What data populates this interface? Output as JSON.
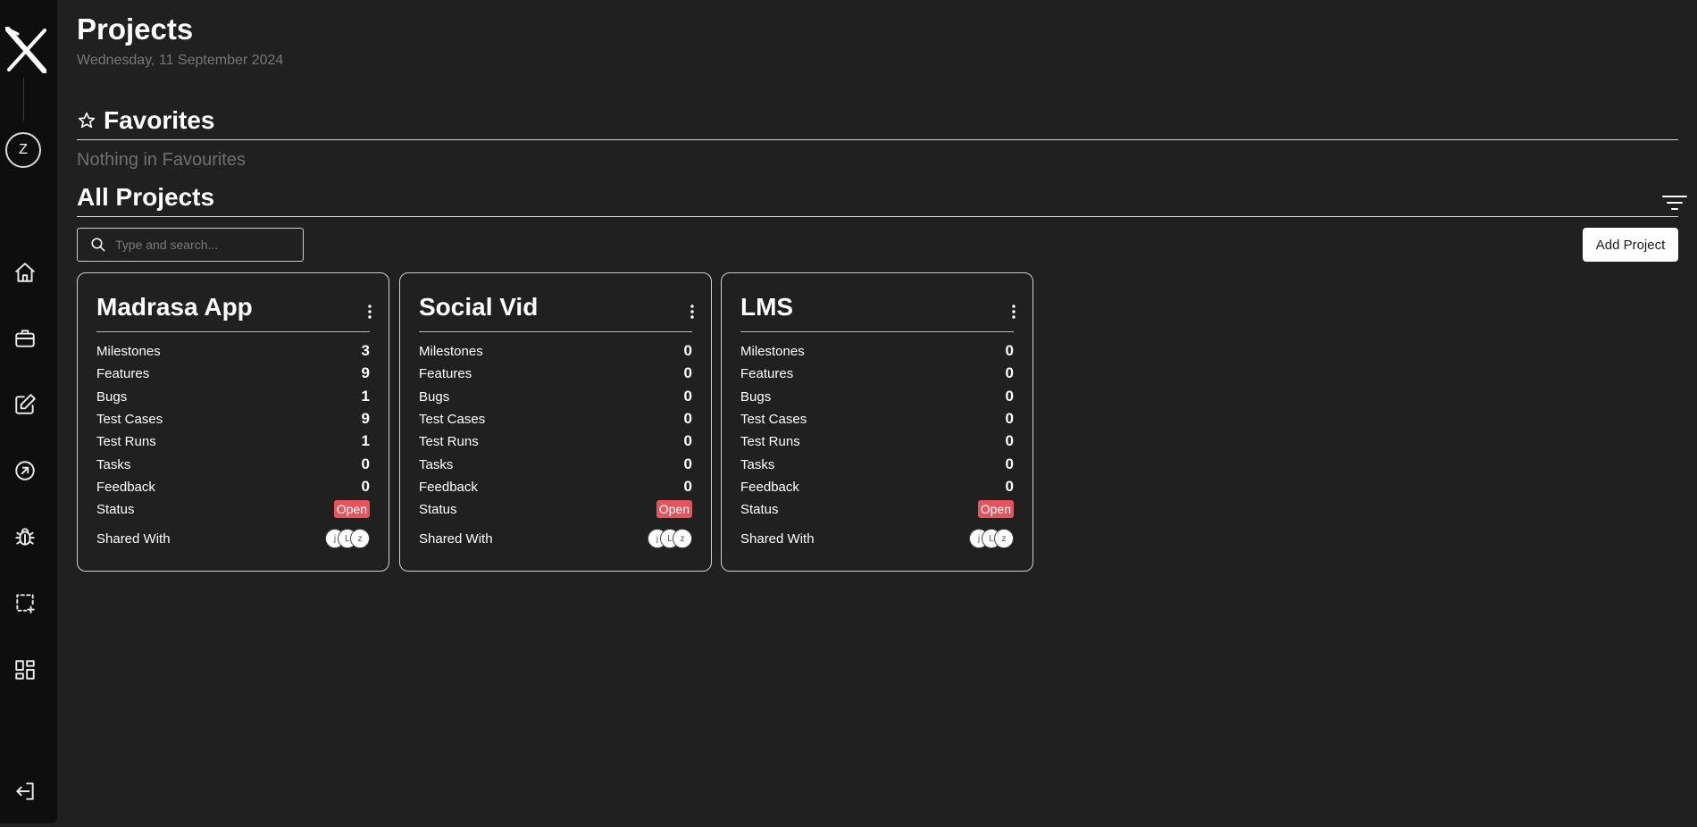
{
  "user": {
    "initial": "Z"
  },
  "header": {
    "title": "Projects",
    "date": "Wednesday, 11 September 2024"
  },
  "favorites": {
    "title": "Favorites",
    "empty_text": "Nothing in Favourites"
  },
  "all_projects": {
    "title": "All Projects",
    "search_placeholder": "Type and search...",
    "add_label": "Add Project"
  },
  "nav": [
    "home-icon",
    "briefcase-icon",
    "edit-icon",
    "arrow-circle-icon",
    "bug-icon",
    "selection-add-icon",
    "dashboard-icon",
    "logout-icon"
  ],
  "colors": {
    "background": "#202020",
    "sidebar": "#0e0e0e",
    "status_open": "#e5545c"
  },
  "labels": {
    "milestones": "Milestones",
    "features": "Features",
    "bugs": "Bugs",
    "test_cases": "Test Cases",
    "test_runs": "Test Runs",
    "tasks": "Tasks",
    "feedback": "Feedback",
    "status": "Status",
    "shared_with": "Shared With"
  },
  "projects": [
    {
      "name": "Madrasa App",
      "milestones": "3",
      "features": "9",
      "bugs": "1",
      "test_cases": "9",
      "test_runs": "1",
      "tasks": "0",
      "feedback": "0",
      "status": "Open",
      "shared": [
        "j",
        "L",
        "z"
      ]
    },
    {
      "name": "Social Vid",
      "milestones": "0",
      "features": "0",
      "bugs": "0",
      "test_cases": "0",
      "test_runs": "0",
      "tasks": "0",
      "feedback": "0",
      "status": "Open",
      "shared": [
        "j",
        "L",
        "z"
      ]
    },
    {
      "name": "LMS",
      "milestones": "0",
      "features": "0",
      "bugs": "0",
      "test_cases": "0",
      "test_runs": "0",
      "tasks": "0",
      "feedback": "0",
      "status": "Open",
      "shared": [
        "j",
        "L",
        "z"
      ]
    }
  ]
}
